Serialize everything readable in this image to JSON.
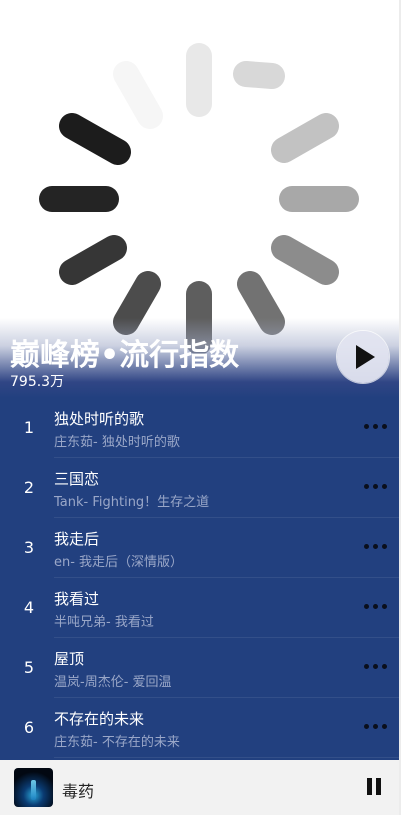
{
  "header": {
    "title": "巅峰榜•流行指数",
    "listen_count": "795.3万",
    "play_all_icon": "play-icon"
  },
  "songs": [
    {
      "index": "1",
      "name": "独处时听的歌",
      "sub": "庄东茹- 独处时听的歌"
    },
    {
      "index": "2",
      "name": "三国恋",
      "sub": "Tank- Fighting！生存之道"
    },
    {
      "index": "3",
      "name": "我走后",
      "sub": "en- 我走后（深情版）"
    },
    {
      "index": "4",
      "name": "我看过",
      "sub": "半吨兄弟- 我看过"
    },
    {
      "index": "5",
      "name": "屋顶",
      "sub": "温岚-周杰伦- 爱回温"
    },
    {
      "index": "6",
      "name": "不存在的未来",
      "sub": "庄东茹- 不存在的未来"
    }
  ],
  "player": {
    "now_playing": "毒药",
    "state_icon": "pause-icon"
  },
  "colors": {
    "list_bg": "#22407f",
    "subtitle": "#9aa7c8",
    "player_bg": "#f2f2f2"
  }
}
